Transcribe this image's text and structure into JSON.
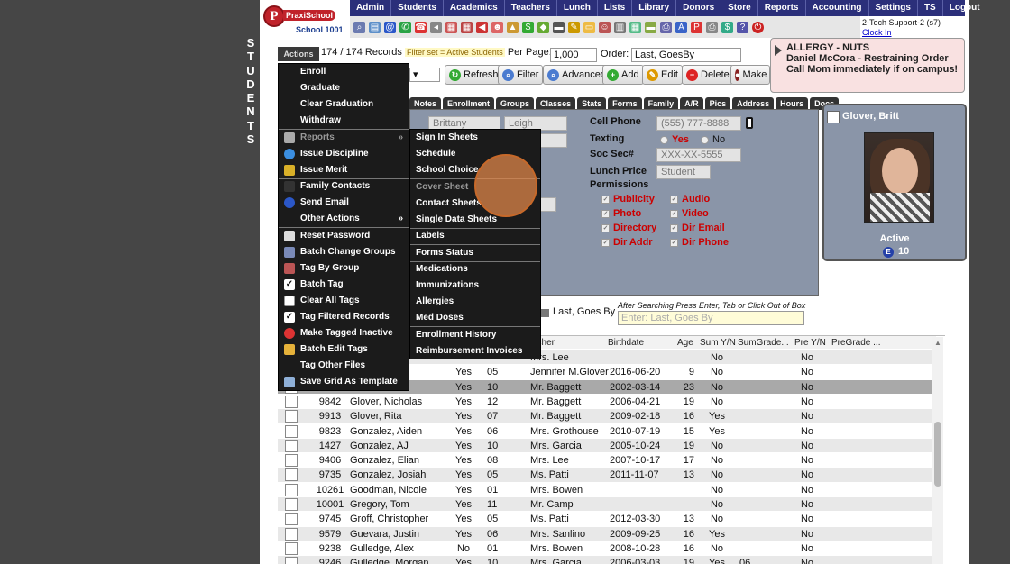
{
  "app": {
    "logo_name": "PraxiSchool",
    "logo_mark": "P",
    "school": "School 1001",
    "side_label": [
      "S",
      "T",
      "U",
      "D",
      "E",
      "N",
      "T",
      "S"
    ]
  },
  "menubar": [
    "Admin",
    "Students",
    "Academics",
    "Teachers",
    "Lunch",
    "Lists",
    "Library",
    "Donors",
    "Store",
    "Reports",
    "Accounting",
    "Settings",
    "TS",
    "Logout"
  ],
  "user": {
    "name": "2-Tech Support-2 (s7)",
    "clock": "Clock In"
  },
  "toolbar": {
    "actions_label": "Actions",
    "records": "174 / 174 Records",
    "filter_set": "Filter set = Active Students",
    "per_page_label": "Per Page:",
    "per_page_value": "1,000",
    "order_label": "Order:",
    "order_value": "Last, GoesBy",
    "buttons": {
      "refresh": "Refresh",
      "filter": "Filter",
      "advanced": "Advanced",
      "add": "Add",
      "edit": "Edit",
      "delete": "Delete",
      "make": "Make"
    }
  },
  "alert": {
    "line1": "ALLERGY - NUTS",
    "line2": "Daniel McCora - Restraining Order",
    "line3": "Call Mom immediately if on campus!"
  },
  "tabs": [
    "Notes",
    "Enrollment",
    "Groups",
    "Classes",
    "Stats",
    "Forms",
    "Family",
    "A/R",
    "Pics",
    "Address",
    "Hours",
    "Docs"
  ],
  "detail": {
    "first": "Brittany",
    "last": "Leigh",
    "cell_label": "Cell Phone",
    "cell_value": "(555) 777-8888",
    "texting_label": "Texting",
    "texting_yes": "Yes",
    "texting_no": "No",
    "ssn_label": "Soc Sec#",
    "ssn_value": "XXX-XX-5555",
    "lunch_label": "Lunch Price",
    "lunch_value": "Student",
    "perm_label": "Permissions",
    "perms": [
      "Publicity",
      "Audio",
      "Photo",
      "Video",
      "Directory",
      "Dir Email",
      "Dir Addr",
      "Dir Phone"
    ]
  },
  "student_card": {
    "name": "Glover, Britt",
    "status": "Active",
    "grade": "10",
    "badge": "E"
  },
  "search": {
    "label": "Last, Goes By",
    "hint": "After Searching Press Enter, Tab or Click Out of Box",
    "placeholder": "Enter: Last, Goes By"
  },
  "grid": {
    "headers": [
      "acher",
      "Birthdate",
      "Age",
      "Sum Y/N",
      "SumGrade...",
      "Pre Y/N",
      "PreGrade ..."
    ],
    "rows": [
      {
        "id": "",
        "name": "",
        "yn": "",
        "gr": "",
        "teacher": "Mrs. Lee",
        "birth": "",
        "age": "",
        "sum": "No",
        "sg": "",
        "pre": "No"
      },
      {
        "id": "",
        "name": "",
        "yn": "Yes",
        "gr": "05",
        "teacher": "Jennifer M.Glover",
        "birth": "2016-06-20",
        "age": "9",
        "sum": "No",
        "sg": "",
        "pre": "No"
      },
      {
        "id": "",
        "name": "",
        "yn": "Yes",
        "gr": "10",
        "teacher": "Mr. Baggett",
        "birth": "2002-03-14",
        "age": "23",
        "sum": "No",
        "sg": "",
        "pre": "No",
        "sel": true
      },
      {
        "id": "9842",
        "name": "Glover, Nicholas",
        "yn": "Yes",
        "gr": "12",
        "teacher": "Mr. Baggett",
        "birth": "2006-04-21",
        "age": "19",
        "sum": "No",
        "sg": "",
        "pre": "No"
      },
      {
        "id": "9913",
        "name": "Glover, Rita",
        "yn": "Yes",
        "gr": "07",
        "teacher": "Mr. Baggett",
        "birth": "2009-02-18",
        "age": "16",
        "sum": "Yes",
        "sg": "",
        "pre": "No"
      },
      {
        "id": "9823",
        "name": "Gonzalez, Aiden",
        "yn": "Yes",
        "gr": "06",
        "teacher": "Mrs. Grothouse",
        "birth": "2010-07-19",
        "age": "15",
        "sum": "Yes",
        "sg": "",
        "pre": "No"
      },
      {
        "id": "1427",
        "name": "Gonzalez, AJ",
        "yn": "Yes",
        "gr": "10",
        "teacher": "Mrs. Garcia",
        "birth": "2005-10-24",
        "age": "19",
        "sum": "No",
        "sg": "",
        "pre": "No"
      },
      {
        "id": "9406",
        "name": "Gonzalez, Elian",
        "yn": "Yes",
        "gr": "08",
        "teacher": "Mrs. Lee",
        "birth": "2007-10-17",
        "age": "17",
        "sum": "No",
        "sg": "",
        "pre": "No"
      },
      {
        "id": "9735",
        "name": "Gonzalez, Josiah",
        "yn": "Yes",
        "gr": "05",
        "teacher": "Ms. Patti",
        "birth": "2011-11-07",
        "age": "13",
        "sum": "No",
        "sg": "",
        "pre": "No"
      },
      {
        "id": "10261",
        "name": "Goodman, Nicole",
        "yn": "Yes",
        "gr": "01",
        "teacher": "Mrs. Bowen",
        "birth": "",
        "age": "",
        "sum": "No",
        "sg": "",
        "pre": "No"
      },
      {
        "id": "10001",
        "name": "Gregory, Tom",
        "yn": "Yes",
        "gr": "11",
        "teacher": "Mr. Camp",
        "birth": "",
        "age": "",
        "sum": "No",
        "sg": "",
        "pre": "No"
      },
      {
        "id": "9745",
        "name": "Groff, Christopher",
        "yn": "Yes",
        "gr": "05",
        "teacher": "Ms. Patti",
        "birth": "2012-03-30",
        "age": "13",
        "sum": "No",
        "sg": "",
        "pre": "No"
      },
      {
        "id": "9579",
        "name": "Guevara, Justin",
        "yn": "Yes",
        "gr": "06",
        "teacher": "Mrs. Sanlino",
        "birth": "2009-09-25",
        "age": "16",
        "sum": "Yes",
        "sg": "",
        "pre": "No"
      },
      {
        "id": "9238",
        "name": "Gulledge, Alex",
        "yn": "No",
        "gr": "01",
        "teacher": "Mrs. Bowen",
        "birth": "2008-10-28",
        "age": "16",
        "sum": "No",
        "sg": "",
        "pre": "No"
      },
      {
        "id": "9246",
        "name": "Gulledge, Morgan",
        "yn": "Yes",
        "gr": "10",
        "teacher": "Mrs. Garcia",
        "birth": "2006-03-03",
        "age": "19",
        "sum": "Yes",
        "sg": "06",
        "pre": "No"
      }
    ]
  },
  "actions_menu": [
    {
      "label": "Enroll",
      "icon": ""
    },
    {
      "label": "Graduate",
      "icon": ""
    },
    {
      "label": "Clear Graduation",
      "icon": ""
    },
    {
      "label": "Withdraw",
      "icon": "",
      "sep": true
    },
    {
      "label": "Reports",
      "icon": "print-icon",
      "dim": true,
      "arrow": "»"
    },
    {
      "label": "Issue Discipline",
      "icon": "discipline-icon"
    },
    {
      "label": "Issue Merit",
      "icon": "merit-icon",
      "sep": true
    },
    {
      "label": "Family Contacts",
      "icon": "phone-icon"
    },
    {
      "label": "Send Email",
      "icon": "email-icon"
    },
    {
      "label": "Other Actions",
      "icon": "",
      "arrow": "»",
      "sep": true
    },
    {
      "label": "Reset Password",
      "icon": "key-icon"
    },
    {
      "label": "Batch Change Groups",
      "icon": "groups-icon"
    },
    {
      "label": "Tag By Group",
      "icon": "tag-icon",
      "sep": true
    },
    {
      "label": "Batch Tag",
      "icon": "checkbox-icon"
    },
    {
      "label": "Clear All Tags",
      "icon": "empty-box-icon"
    },
    {
      "label": "Tag Filtered Records",
      "icon": "checkbox-icon"
    },
    {
      "label": "Make Tagged Inactive",
      "icon": "inactive-icon"
    },
    {
      "label": "Batch Edit Tags",
      "icon": "pencil-icon"
    },
    {
      "label": "Tag Other Files",
      "icon": ""
    },
    {
      "label": "Save Grid As Template",
      "icon": "grid-icon"
    }
  ],
  "reports_menu": [
    {
      "label": "Sign In Sheets"
    },
    {
      "label": "Schedule"
    },
    {
      "label": "School Choice",
      "sep": true
    },
    {
      "label": "Cover Sheet",
      "dim": true
    },
    {
      "label": "Contact Sheets"
    },
    {
      "label": "Single Data Sheets",
      "sep": true
    },
    {
      "label": "Labels",
      "sep": true
    },
    {
      "label": "Forms Status",
      "sep": true
    },
    {
      "label": "Medications"
    },
    {
      "label": "Immunizations"
    },
    {
      "label": "Allergies"
    },
    {
      "label": "Med Doses",
      "sep": true
    },
    {
      "label": "Enrollment History"
    },
    {
      "label": "Reimbursement Invoices"
    }
  ],
  "colors": {
    "menubar": "#2b2f7a",
    "panel": "#8a95a8",
    "alert_bg": "#f9e1e1",
    "cursor": "#de864a"
  }
}
